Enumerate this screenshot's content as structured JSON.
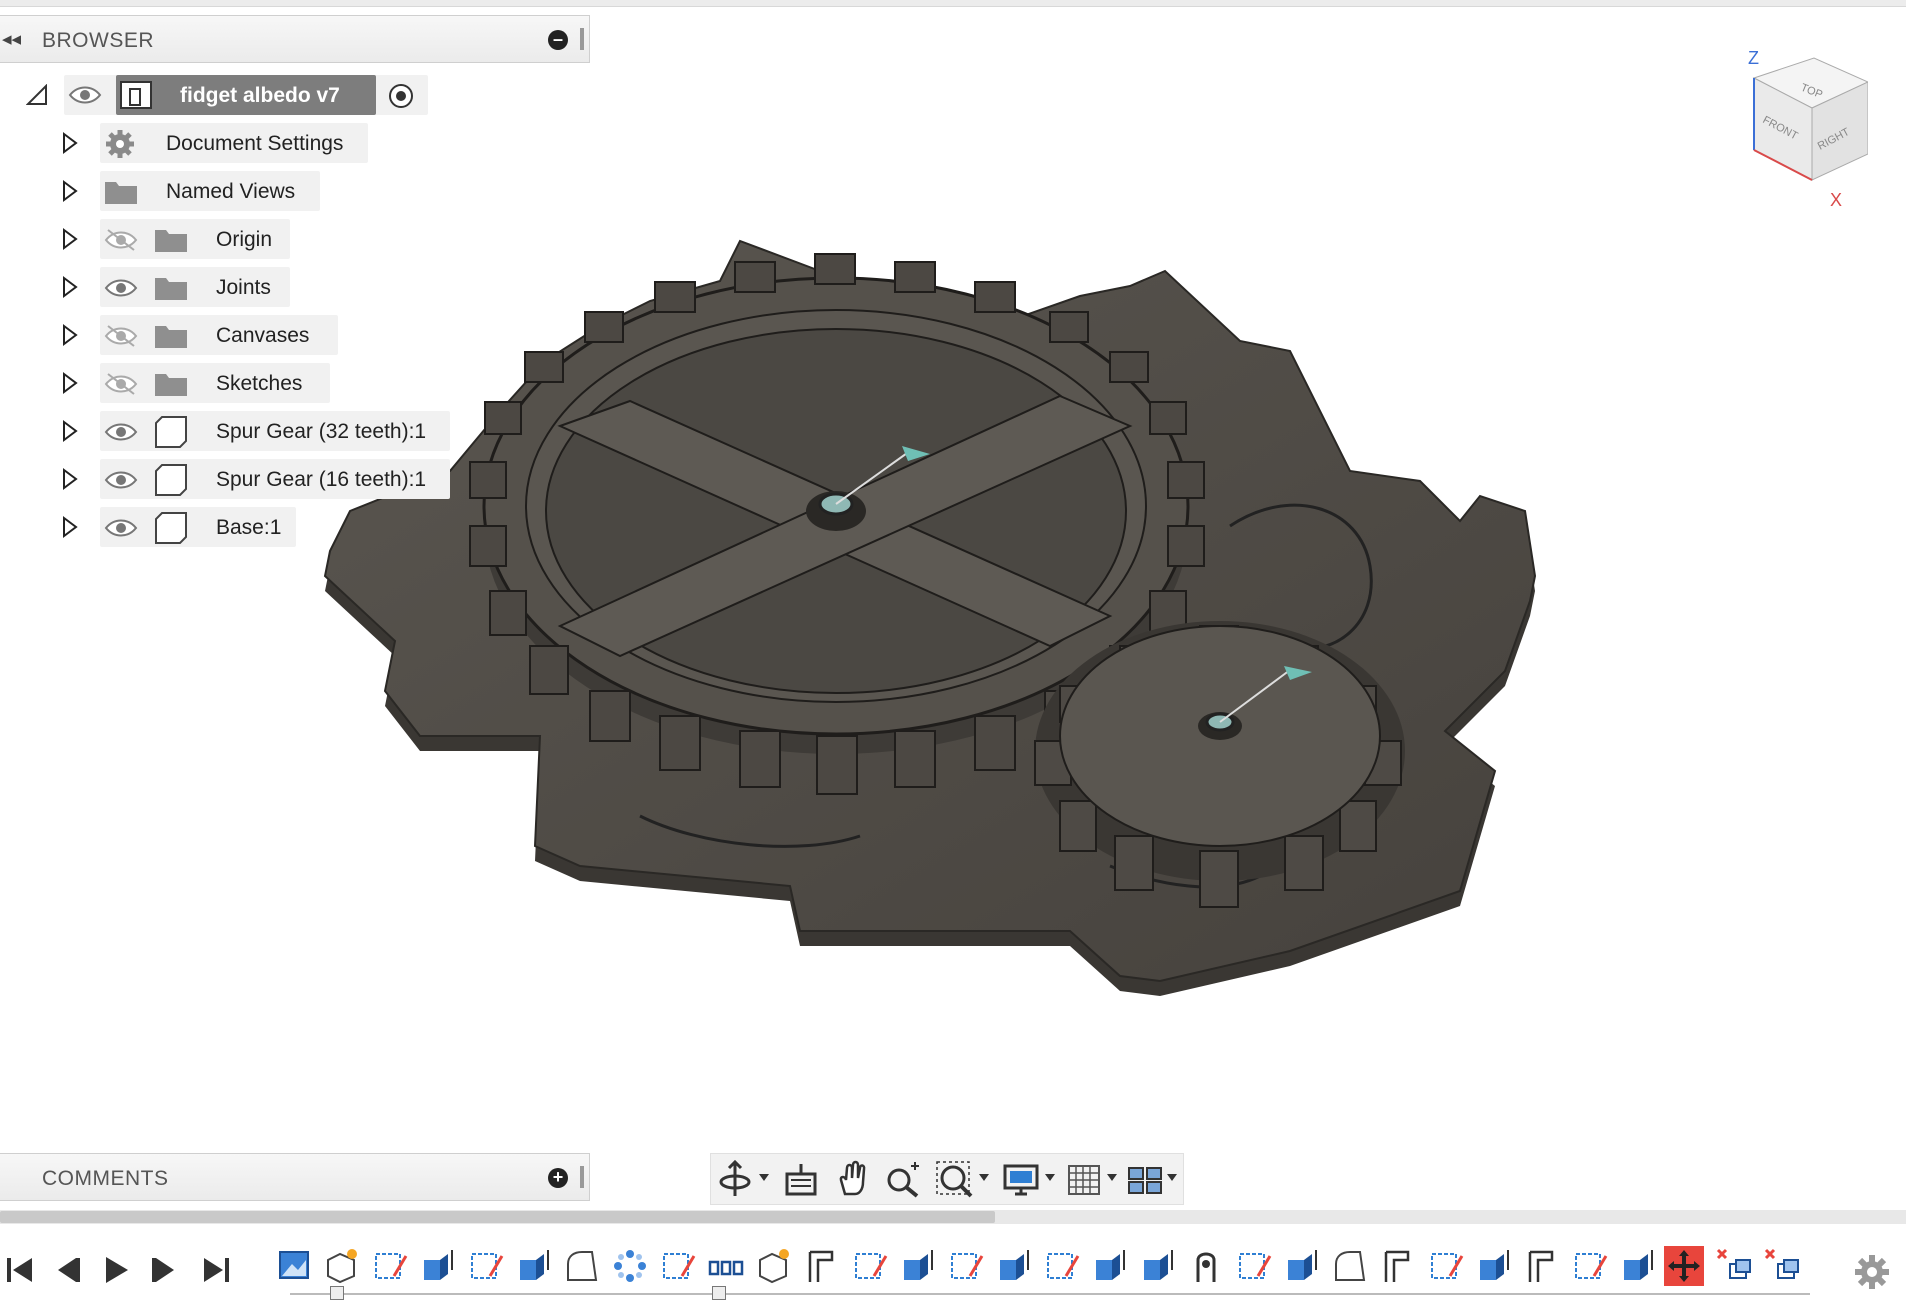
{
  "browser": {
    "title": "BROWSER",
    "root": {
      "label": "fidget albedo v7"
    },
    "items": [
      {
        "label": "Document Settings",
        "icon": "gear-icon",
        "eye": "none"
      },
      {
        "label": "Named Views",
        "icon": "folder-icon",
        "eye": "none"
      },
      {
        "label": "Origin",
        "icon": "folder-icon",
        "eye": "hidden"
      },
      {
        "label": "Joints",
        "icon": "folder-icon",
        "eye": "visible"
      },
      {
        "label": "Canvases",
        "icon": "folder-icon",
        "eye": "hidden"
      },
      {
        "label": "Sketches",
        "icon": "folder-icon",
        "eye": "hidden"
      },
      {
        "label": "Spur Gear (32 teeth):1",
        "icon": "component-icon",
        "eye": "visible"
      },
      {
        "label": "Spur Gear (16 teeth):1",
        "icon": "component-icon",
        "eye": "visible"
      },
      {
        "label": "Base:1",
        "icon": "component-icon",
        "eye": "visible"
      }
    ]
  },
  "viewcube": {
    "top": "TOP",
    "front": "FRONT",
    "right": "RIGHT",
    "z_axis": "Z",
    "x_axis": "X"
  },
  "comments": {
    "title": "COMMENTS"
  },
  "colors": {
    "model": "#4a4641",
    "accent_red": "#e8453c",
    "accent_blue": "#2f7fd3"
  }
}
